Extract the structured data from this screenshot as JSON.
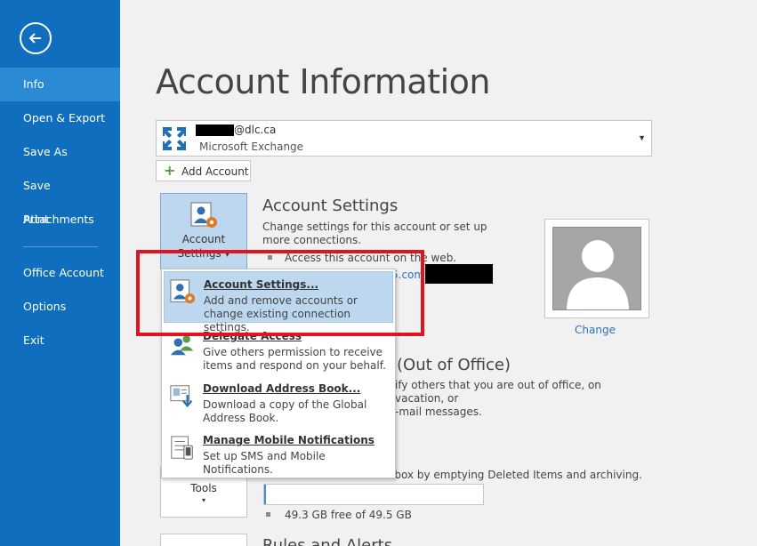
{
  "colors": {
    "sidebar": "#106ebe",
    "sidebar_active": "#2a8ad4",
    "highlight": "#bdd7ee",
    "link": "#2e72b8",
    "annotation_red": "#e0141e"
  },
  "sidebar": {
    "items": [
      {
        "label": "Info",
        "active": true
      },
      {
        "label": "Open & Export"
      },
      {
        "label": "Save As"
      },
      {
        "label": "Save Attachments"
      },
      {
        "label": "Print"
      },
      {
        "label": "Office Account"
      },
      {
        "label": "Options"
      },
      {
        "label": "Exit"
      }
    ]
  },
  "page": {
    "title": "Account Information"
  },
  "account_select": {
    "email_suffix": "@dlc.ca",
    "type": "Microsoft Exchange"
  },
  "add_account": {
    "label": "Add Account"
  },
  "account_settings": {
    "button_line1": "Account",
    "button_line2": "Settings ▾",
    "title": "Account Settings",
    "desc": "Change settings for this account or set up more connections.",
    "bullet": "Access this account on the web.",
    "link_tail": "5.com"
  },
  "photo": {
    "change_label": "Change"
  },
  "auto_replies": {
    "title_tail": "(Out of Office)",
    "desc_tail": "ify others that you are out of office, on vacation, or\n-mail messages."
  },
  "mailbox": {
    "desc_tail": "lbox by emptying Deleted Items and archiving.",
    "storage_text": "49.3 GB free of 49.5 GB",
    "used_fraction": 0.004
  },
  "tools": {
    "label": "Tools",
    "caret": "▾"
  },
  "rules": {
    "title": "Rules and Alerts"
  },
  "dropdown": {
    "items": [
      {
        "title": "Account Settings...",
        "desc": "Add and remove accounts or change existing connection settings."
      },
      {
        "title": "Delegate Access",
        "desc": "Give others permission to receive items and respond on your behalf."
      },
      {
        "title": "Download Address Book...",
        "desc": "Download a copy of the Global Address Book."
      },
      {
        "title": "Manage Mobile Notifications",
        "desc": "Set up SMS and Mobile Notifications."
      }
    ]
  }
}
